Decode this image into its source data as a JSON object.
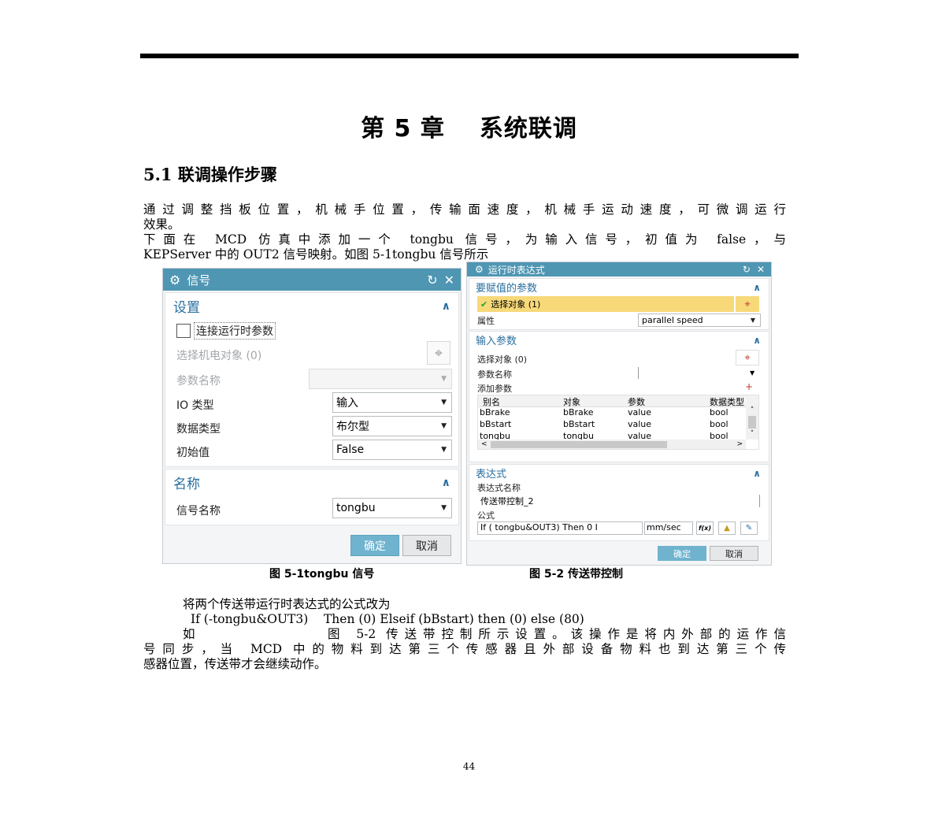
{
  "chapter": {
    "title_num": "第 5 章",
    "title_text": "系统联调"
  },
  "section": {
    "title": "5.1 联调操作步骤"
  },
  "para1": {
    "line1": "通过调整挡板位置，机械手位置，传输面速度，机械手运动速度，可微调运行",
    "line2": "效果。"
  },
  "para2": {
    "line1": "下面在 MCD 仿真中添加一个 tongbu 信号，为输入信号，初值为 false，与",
    "line2": "KEPServer 中的 OUT2 信号映射。如图 5-1tongbu 信号所示"
  },
  "signal_dialog": {
    "title": "信号",
    "settings_header": "设置",
    "connect_runtime_label": "连接运行时参数",
    "select_object_label": "选择机电对象 (0)",
    "param_name_label": "参数名称",
    "io_type_label": "IO 类型",
    "io_type_value": "输入",
    "data_type_label": "数据类型",
    "data_type_value": "布尔型",
    "initial_value_label": "初始值",
    "initial_value_value": "False",
    "name_header": "名称",
    "signal_name_label": "信号名称",
    "signal_name_value": "tongbu",
    "ok_label": "确定",
    "cancel_label": "取消"
  },
  "expr_dialog": {
    "title": "运行时表达式",
    "assign_header": "要赋值的参数",
    "select_object_label": "选择对象 (1)",
    "property_label": "属性",
    "property_value": "parallel speed",
    "input_header": "输入参数",
    "input_select_label": "选择对象 (0)",
    "param_name_label": "参数名称",
    "add_param_label": "添加参数",
    "columns": [
      "别名",
      "对象",
      "参数",
      "数据类型"
    ],
    "rows": [
      [
        "bBrake",
        "bBrake",
        "value",
        "bool"
      ],
      [
        "bBstart",
        "bBstart",
        "value",
        "bool"
      ],
      [
        "tongbu",
        "tongbu",
        "value",
        "bool"
      ]
    ],
    "expr_header": "表达式",
    "expr_name_label": "表达式名称",
    "expr_name_value": "传送带控制_2",
    "formula_label": "公式",
    "formula_value": "If ( tongbu&OUT3) Then 0 I",
    "unit_value": "mm/sec",
    "fx_label": "f(x)",
    "ok_label": "确定",
    "cancel_label": "取消"
  },
  "captions": {
    "fig1": "图 5-1tongbu 信号",
    "fig2": "图 5-2 传送带控制"
  },
  "para3": {
    "line1": "将两个传送带运行时表达式的公式改为",
    "line2": "If (-tongbu&OUT3)    Then (0) Elseif (bBstart) then (0) else (80)",
    "line3a": "如",
    "line3b": "图 5-2 传送带控制所示设置。该操作是将内外部的运作信",
    "line4": "号同步，当 MCD 中的物料到达第三个传感器且外部设备物料也到达第三个传",
    "line5": "感器位置，传送带才会继续动作。"
  },
  "page_number": "44",
  "colors": {
    "title_bar": "#4f96b3",
    "highlight": "#f7d97a",
    "primary_button": "#6fb3cf",
    "header_text": "#2a6fa0"
  }
}
